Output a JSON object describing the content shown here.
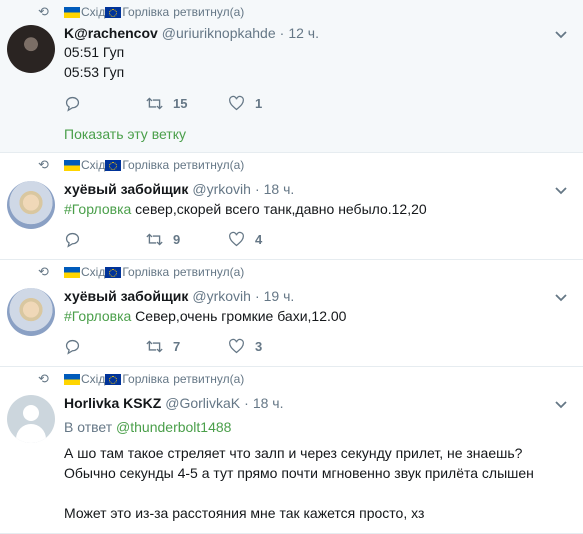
{
  "tweets": [
    {
      "context": {
        "retweeter": "Схід",
        "retweeter2": "Горлівка",
        "suffix": "ретвитнул(а)"
      },
      "fullname": "K@rachencov",
      "handle": "@uriuriknopkahde",
      "time": "12 ч.",
      "lines": [
        "05:51 Гуп",
        "05:53 Гуп"
      ],
      "actions": {
        "reply": "",
        "retweets": "15",
        "likes": "1"
      },
      "show_thread": "Показать эту ветку"
    },
    {
      "context": {
        "retweeter": "Схід",
        "retweeter2": "Горлівка",
        "suffix": "ретвитнул(а)"
      },
      "fullname": "хуёвый забойщик",
      "handle": "@yrkovih",
      "time": "18 ч.",
      "hashtag": "#Горловка",
      "text": " север,скорей всего танк,давно небыло.12,20",
      "actions": {
        "reply": "",
        "retweets": "9",
        "likes": "4"
      }
    },
    {
      "context": {
        "retweeter": "Схід",
        "retweeter2": "Горлівка",
        "suffix": "ретвитнул(а)"
      },
      "fullname": "хуёвый забойщик",
      "handle": "@yrkovih",
      "time": "19 ч.",
      "hashtag": "#Горловка",
      "text": " Север,очень громкие бахи,12.00",
      "actions": {
        "reply": "",
        "retweets": "7",
        "likes": "3"
      }
    },
    {
      "context": {
        "retweeter": "Схід",
        "retweeter2": "Горлівка",
        "suffix": "ретвитнул(а)"
      },
      "fullname": "Horlivka KSKZ",
      "handle": "@GorlivkaK",
      "time": "18 ч.",
      "reply_prefix": "В ответ ",
      "reply_handle": "@thunderbolt1488",
      "line1": "А шо там такое стреляет что залп и через секунду прилет, не знаешь?",
      "line2": "Обычно секунды 4-5 а тут прямо почти мгновенно звук прилёта слышен",
      "line3": "Может это из-за расстояния мне так кажется просто, хз"
    }
  ],
  "colors": {
    "accent": "#4a9f4a",
    "muted": "#657786",
    "highlight_bg": "#f5f8fa",
    "divider": "#e6ecf0"
  },
  "icons": {
    "retweet_context": "retweet-icon",
    "reply": "reply-icon",
    "retweet": "retweet-icon",
    "like": "heart-icon",
    "more": "chevron-down-icon"
  }
}
